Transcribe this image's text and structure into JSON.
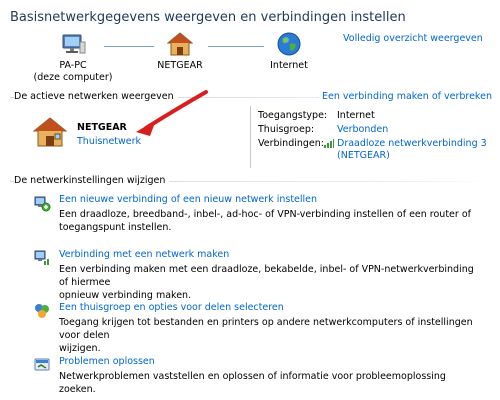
{
  "page": {
    "title": "Basisnetwerkgegevens weergeven en verbindingen instellen",
    "full_map_link": "Volledig overzicht weergeven"
  },
  "network_map": {
    "pc": {
      "name": "PA-PC",
      "sub": "(deze computer)",
      "icon": "computer-icon"
    },
    "router": {
      "name": "NETGEAR",
      "icon": "house-icon"
    },
    "internet": {
      "name": "Internet",
      "icon": "globe-icon"
    }
  },
  "active_networks": {
    "heading": "De actieve netwerken weergeven",
    "connect_link": "Een verbinding maken of verbreken",
    "network_name": "NETGEAR",
    "network_type": "Thuisnetwerk",
    "details": [
      {
        "label": "Toegangstype:",
        "value": "Internet",
        "is_link": false
      },
      {
        "label": "Thuisgroep:",
        "value": "Verbonden",
        "is_link": true
      },
      {
        "label": "Verbindingen:",
        "value": "Draadloze netwerkverbinding 3",
        "value2": "(NETGEAR)",
        "is_link": true
      }
    ]
  },
  "settings": {
    "heading": "De netwerkinstellingen wijzigen",
    "tasks": [
      {
        "title": "Een nieuwe verbinding of een nieuw netwerk instellen",
        "desc1": "Een draadloze, breedband-, inbel-, ad-hoc- of VPN-verbinding instellen of een router of",
        "desc2": "toegangspunt instellen.",
        "icon": "new-connection-icon"
      },
      {
        "title": "Verbinding met een netwerk maken",
        "desc1": "Een verbinding maken met een draadloze, bekabelde, inbel- of VPN-netwerkverbinding of hiermee",
        "desc2": "opnieuw verbinding maken.",
        "icon": "connect-network-icon"
      },
      {
        "title": "Een thuisgroep en opties voor delen selecteren",
        "desc1": "Toegang krijgen tot bestanden en printers op andere netwerkcomputers of instellingen voor delen",
        "desc2": "wijzigen.",
        "icon": "homegroup-icon"
      },
      {
        "title": "Problemen oplossen",
        "desc1": "Netwerkproblemen vaststellen en oplossen of informatie voor probleemoplossing zoeken.",
        "desc2": "",
        "icon": "troubleshoot-icon"
      }
    ]
  },
  "colors": {
    "link": "#0066cc",
    "title": "#1e395b",
    "annotation_arrow": "#d81e1e"
  }
}
